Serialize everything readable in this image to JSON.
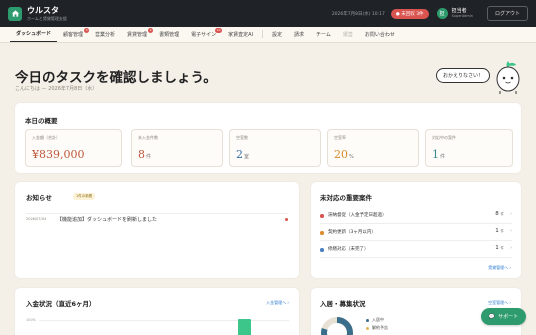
{
  "app": {
    "name": "ウルスタ",
    "tagline": "ホームと賃貸管理支援",
    "logo_icon": "logo-icon"
  },
  "topbar": {
    "date": "2026年7月8日(水) 10:17",
    "unpaid_badge": "未回収 3件",
    "user_initial": "担",
    "user_name": "担当者",
    "user_role": "SuperAdmin",
    "logout_label": "ログアウト"
  },
  "nav": {
    "items": [
      {
        "label": "ダッシュボード",
        "active": true
      },
      {
        "label": "顧客管理",
        "badge": "3"
      },
      {
        "label": "営業分析"
      },
      {
        "label": "賃貸管理",
        "badge": "4"
      },
      {
        "label": "書類管理"
      },
      {
        "label": "電子サイン",
        "badge": "10"
      },
      {
        "label": "家賃査定AI"
      },
      {
        "label": "設定"
      },
      {
        "label": "請求"
      },
      {
        "label": "チーム"
      },
      {
        "label": "運営",
        "muted": true
      },
      {
        "label": "お問い合わせ"
      }
    ]
  },
  "header": {
    "title": "今日のタスクを確認しましょう。",
    "subtitle": "こんにちは — 2026年7月8日（水）",
    "bubble": "おかえりなさい！"
  },
  "overview": {
    "title": "本日の概要",
    "stats": [
      {
        "label": "入金額（合計）",
        "value": "¥839,000",
        "unit": "",
        "color": "#c0573b"
      },
      {
        "label": "未入金件数",
        "value": "8",
        "unit": "件",
        "color": "#c0573b"
      },
      {
        "label": "空室数",
        "value": "2",
        "unit": "室",
        "color": "#3a6ea5"
      },
      {
        "label": "空室率",
        "value": "20",
        "unit": "%",
        "color": "#d98b2b"
      },
      {
        "label": "対応中の案件",
        "value": "1",
        "unit": "件",
        "color": "#3a8a8a"
      }
    ]
  },
  "news": {
    "title": "お知らせ",
    "badge": "1件の新着",
    "items": [
      {
        "date": "2026/07/04",
        "text": "【機能追加】ダッシュボードを刷新しました"
      }
    ]
  },
  "issues": {
    "title": "未対応の重要案件",
    "items": [
      {
        "label": "滞納督促（入金予定日超過）",
        "count": "8",
        "unit": "件",
        "color": "#d9534f"
      },
      {
        "label": "契約更新（3ヶ月以内）",
        "count": "1",
        "unit": "件",
        "color": "#e08a2e"
      },
      {
        "label": "修繕対応（未完了）",
        "count": "1",
        "unit": "件",
        "color": "#4a7fc1"
      }
    ],
    "link": "賃貸管理へ ›"
  },
  "income": {
    "title": "入金状況（直近6ヶ月）",
    "link": "入金管理へ ›",
    "axis_top": "100%"
  },
  "occupancy": {
    "title": "入居・募集状況",
    "link": "空室管理へ ›",
    "legend": [
      {
        "label": "入居中",
        "color": "#3a6e8a"
      },
      {
        "label": "解約予告",
        "color": "#e0b85a"
      }
    ]
  },
  "support_label": "サポート"
}
